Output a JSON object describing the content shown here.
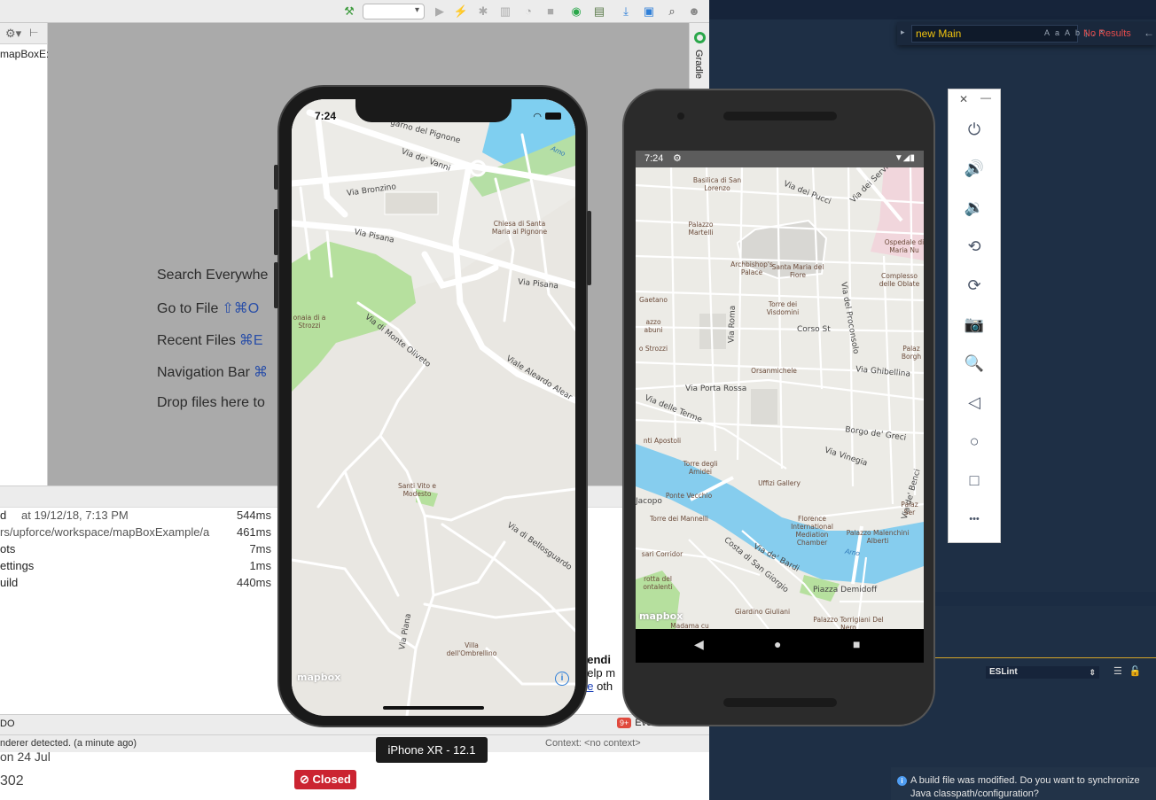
{
  "ide": {
    "project_name": "mapBoxE:",
    "editor_hints": [
      {
        "label": "Search Everywhe",
        "key": ""
      },
      {
        "label": "Go to File",
        "key": "⇧⌘O"
      },
      {
        "label": "Recent Files",
        "key": "⌘E"
      },
      {
        "label": "Navigation Bar",
        "key": "⌘"
      },
      {
        "label": "Drop files here to",
        "key": ""
      }
    ],
    "gradle_label": "Gradle",
    "build_rows": [
      {
        "name": "d",
        "date": "at 19/12/18, 7:13 PM",
        "time": "544ms"
      },
      {
        "name": "rs/upforce/workspace/mapBoxExample/a",
        "date": "",
        "time": "461ms"
      },
      {
        "name": "ots",
        "date": "",
        "time": "7ms"
      },
      {
        "name": "ettings",
        "date": "",
        "time": "1ms"
      },
      {
        "name": "uild",
        "date": "",
        "time": "440ms"
      }
    ],
    "popup": {
      "title": "sendi",
      "line2": "help m",
      "link": "ee",
      "line3_rest": " oth"
    },
    "todo_label": "DO",
    "event_log": {
      "badge": "9+",
      "label": "Eve"
    },
    "status_message": "nderer detected. (a minute ago)",
    "status_context": "Context: <no context>",
    "below": {
      "date": "on 24 Jul",
      "number": "302",
      "closed_label": "Closed",
      "closed_icon": "⊘"
    }
  },
  "device_tooltip": "iPhone XR - 12.1",
  "vscode": {
    "find_query": "new Main",
    "find_options": [
      "Aa",
      "Ab|",
      ".*"
    ],
    "find_result": "No Results",
    "lint_select": "ESLint",
    "notification": "A build file was modified. Do you want to synchronize Java classpath/configuration?"
  },
  "emulator_controls": [
    {
      "name": "power-icon",
      "glyph": "⏻"
    },
    {
      "name": "volume-up-icon",
      "glyph": "🔊"
    },
    {
      "name": "volume-down-icon",
      "glyph": "🔉"
    },
    {
      "name": "rotate-left-icon",
      "glyph": "⟲"
    },
    {
      "name": "rotate-right-icon",
      "glyph": "⟳"
    },
    {
      "name": "camera-icon",
      "glyph": "📷"
    },
    {
      "name": "zoom-icon",
      "glyph": "🔍"
    },
    {
      "name": "back-icon",
      "glyph": "◁"
    },
    {
      "name": "home-icon",
      "glyph": "○"
    },
    {
      "name": "overview-icon",
      "glyph": "□"
    },
    {
      "name": "more-icon",
      "glyph": "•••"
    }
  ],
  "iphone": {
    "time": "7:24",
    "map_labels": [
      {
        "text": "garno del Pignone",
        "cls": "map-label",
        "rot": 15
      },
      {
        "text": "Via de' Vanni",
        "cls": "map-label",
        "rot": 20
      },
      {
        "text": "Via Bronzino",
        "cls": "map-label",
        "rot": -8
      },
      {
        "text": "Chiesa di Santa Maria al Pignone",
        "cls": "map-label poi",
        "rot": 0
      },
      {
        "text": "Via Pisana",
        "cls": "map-label",
        "rot": 12
      },
      {
        "text": "Via Pisana",
        "cls": "map-label",
        "rot": 6
      },
      {
        "text": "onaia di a Strozzi",
        "cls": "map-label poi",
        "rot": 0
      },
      {
        "text": "Via di Monte Oliveto",
        "cls": "map-label",
        "rot": 38
      },
      {
        "text": "Viale Aleardo Alear",
        "cls": "map-label",
        "rot": 32
      },
      {
        "text": "Santi Vito e Modesto",
        "cls": "map-label poi",
        "rot": 0
      },
      {
        "text": "Via di Bellosguardo",
        "cls": "map-label",
        "rot": 35
      },
      {
        "text": "Via Piana",
        "cls": "map-label",
        "rot": -80
      },
      {
        "text": "Villa dell'Ombrellino",
        "cls": "map-label poi",
        "rot": 0
      }
    ],
    "water_label": "Arno",
    "mapbox": "mapbox",
    "info": "i"
  },
  "android": {
    "time": "7:24",
    "map_labels": [
      {
        "text": "Basilica di San Lorenzo",
        "cls": "map-label poi",
        "rot": 0
      },
      {
        "text": "Via dei Pucci",
        "cls": "map-label",
        "rot": 22
      },
      {
        "text": "Via dei Servi",
        "cls": "map-label",
        "rot": -45
      },
      {
        "text": "Palazzo Martelli",
        "cls": "map-label poi",
        "rot": 0
      },
      {
        "text": "Ospedale di Maria Nu",
        "cls": "map-label poi",
        "rot": 0
      },
      {
        "text": "Archbishop's Palace",
        "cls": "map-label poi",
        "rot": 0
      },
      {
        "text": "Santa Maria del Fiore",
        "cls": "map-label poi",
        "rot": 0
      },
      {
        "text": "Complesso delle Oblate",
        "cls": "map-label poi",
        "rot": 0
      },
      {
        "text": "Gaetano",
        "cls": "map-label poi",
        "rot": 0
      },
      {
        "text": "Torre dei Visdomini",
        "cls": "map-label poi",
        "rot": 0
      },
      {
        "text": "Via del Proconsolo",
        "cls": "map-label",
        "rot": 80
      },
      {
        "text": "azzo abuni",
        "cls": "map-label poi",
        "rot": 0
      },
      {
        "text": "Via Roma",
        "cls": "map-label",
        "rot": -88
      },
      {
        "text": "Corso St",
        "cls": "map-label",
        "rot": 0
      },
      {
        "text": "o Strozzi",
        "cls": "map-label poi",
        "rot": 0
      },
      {
        "text": "Orsanmichele",
        "cls": "map-label poi",
        "rot": 0
      },
      {
        "text": "Via Ghibellina",
        "cls": "map-label",
        "rot": 5
      },
      {
        "text": "Palaz Borgh",
        "cls": "map-label poi",
        "rot": 0
      },
      {
        "text": "Via Porta Rossa",
        "cls": "map-label",
        "rot": 0
      },
      {
        "text": "Via delle Terme",
        "cls": "map-label",
        "rot": 22
      },
      {
        "text": "Borgo de' Greci",
        "cls": "map-label",
        "rot": 8
      },
      {
        "text": "nti Apostoli",
        "cls": "map-label poi",
        "rot": 0
      },
      {
        "text": "Via Vinegia",
        "cls": "map-label",
        "rot": 18
      },
      {
        "text": "Torre degli Amidei",
        "cls": "map-label poi",
        "rot": 0
      },
      {
        "text": "Uffizi Gallery",
        "cls": "map-label poi",
        "rot": 0
      },
      {
        "text": "Ponte Vecchio",
        "cls": "map-label poi",
        "rot": 0
      },
      {
        "text": "Via de' Benci",
        "cls": "map-label",
        "rot": -75
      },
      {
        "text": "Palaz Ser",
        "cls": "map-label poi",
        "rot": 0
      },
      {
        "text": "Jacopo",
        "cls": "map-label",
        "rot": 0
      },
      {
        "text": "Torre dei Mannelli",
        "cls": "map-label poi",
        "rot": 0
      },
      {
        "text": "Florence International Mediation Chamber",
        "cls": "map-label poi",
        "rot": 0
      },
      {
        "text": "Palazzo Malenchini Alberti",
        "cls": "map-label poi",
        "rot": 0
      },
      {
        "text": "sari Corridor",
        "cls": "map-label poi",
        "rot": 0
      },
      {
        "text": "Costa di San Giorgio",
        "cls": "map-label",
        "rot": 40
      },
      {
        "text": "Via de' Bardi",
        "cls": "map-label",
        "rot": 28
      },
      {
        "text": "rotta del ontalenti",
        "cls": "map-label poi",
        "rot": 0
      },
      {
        "text": "Piazza Demidoff",
        "cls": "map-label",
        "rot": 0
      },
      {
        "text": "Giardino Giuliani",
        "cls": "map-label poi",
        "rot": 0
      },
      {
        "text": "Palazzo Torrigiani Del Nero",
        "cls": "map-label poi",
        "rot": 0
      },
      {
        "text": "Madama cu",
        "cls": "map-label poi",
        "rot": 0
      }
    ],
    "water_label": "Arno",
    "mapbox": "mapbox",
    "info": "i"
  }
}
